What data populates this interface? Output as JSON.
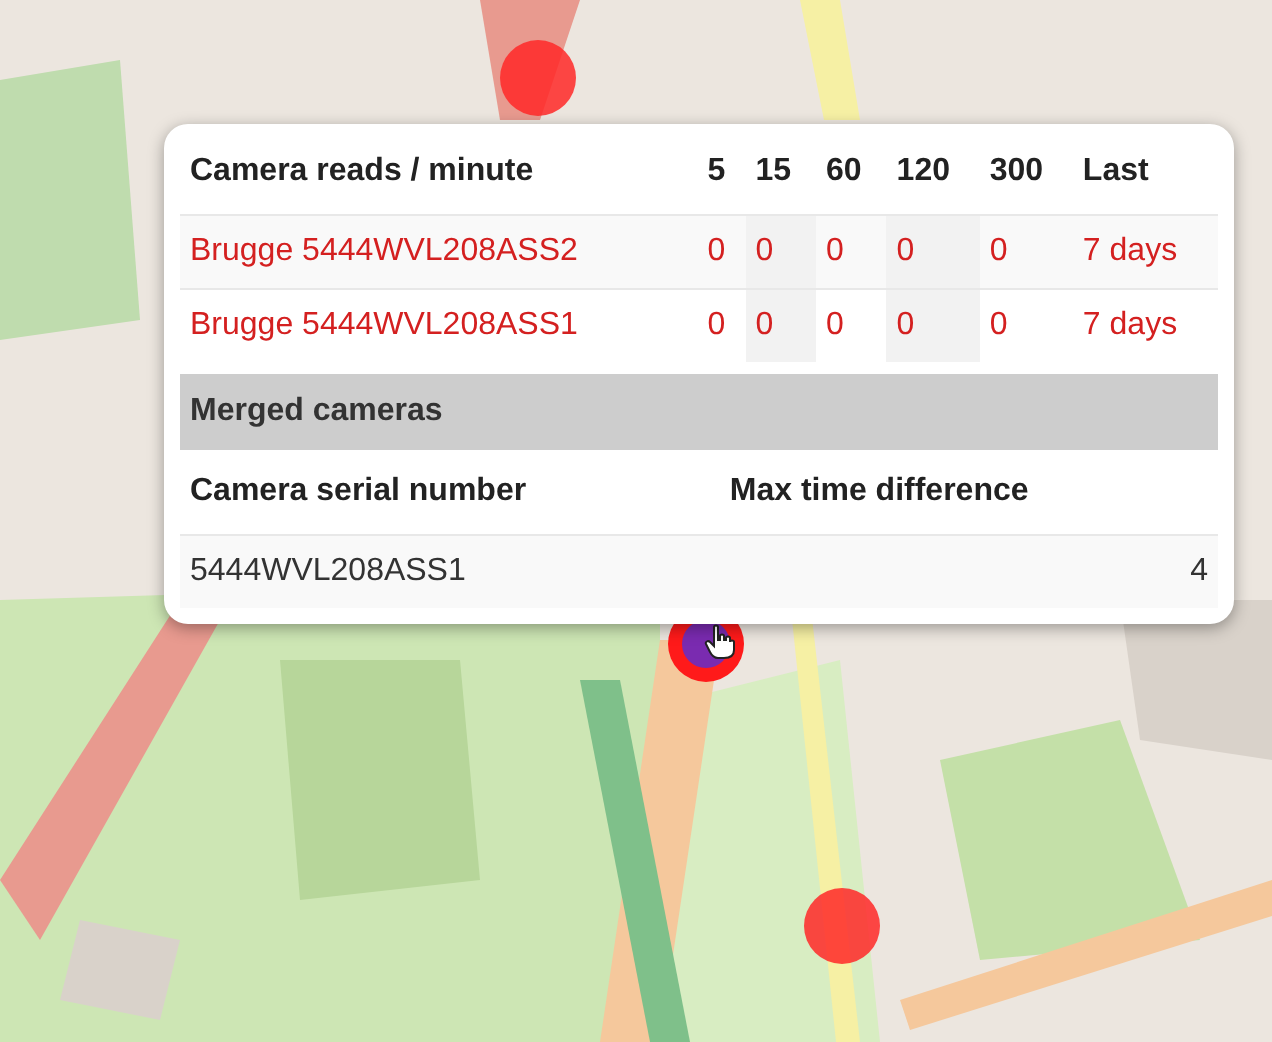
{
  "camera_table": {
    "columns": [
      "Camera reads / minute",
      "5",
      "15",
      "60",
      "120",
      "300",
      "Last"
    ],
    "rows": [
      {
        "name": "Brugge 5444WVL208ASS2",
        "values": [
          "0",
          "0",
          "0",
          "0",
          "0"
        ],
        "last": "7 days"
      },
      {
        "name": "Brugge 5444WVL208ASS1",
        "values": [
          "0",
          "0",
          "0",
          "0",
          "0"
        ],
        "last": "7 days"
      }
    ]
  },
  "merged": {
    "title": "Merged cameras",
    "columns": [
      "Camera serial number",
      "Max time difference"
    ],
    "rows": [
      {
        "serial": "5444WVL208ASS1",
        "max_time_difference": "4"
      }
    ]
  },
  "markers": [
    {
      "selected": false
    },
    {
      "selected": true
    },
    {
      "selected": false
    }
  ]
}
